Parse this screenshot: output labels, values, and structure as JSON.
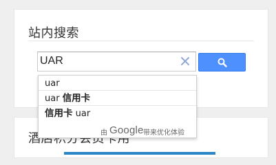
{
  "search_panel": {
    "title": "站内搜索",
    "query": "UAR",
    "clear_icon": "close-icon",
    "search_icon": "search-icon",
    "accent_color": "#4d90fe"
  },
  "suggestions": {
    "items": [
      {
        "plain": "uar",
        "bold": ""
      },
      {
        "plain": "uar ",
        "bold": "信用卡"
      },
      {
        "bold": "信用卡",
        "plain": " uar"
      }
    ],
    "powered_by": "由",
    "brand": "Google",
    "powered_tail": "带来优化体验"
  },
  "next_panel": {
    "title": "酒店积分会员卡用"
  }
}
